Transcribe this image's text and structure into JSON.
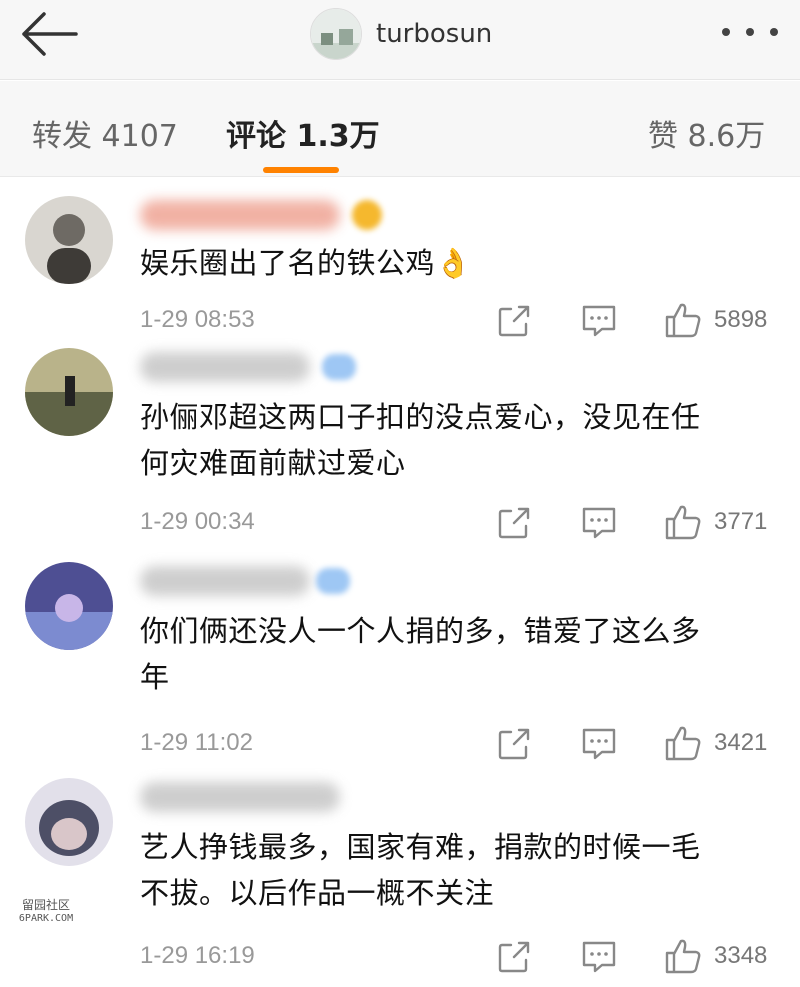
{
  "header": {
    "back_icon": "arrow-left-icon",
    "username": "turbosun",
    "more_icon": "more-dots-icon"
  },
  "tabs": [
    {
      "label": "转发 4107",
      "active": false
    },
    {
      "label": "评论 1.3万",
      "active": true
    },
    {
      "label": "赞 8.6万",
      "active": false
    }
  ],
  "accent_color": "#ff8200",
  "comments": [
    {
      "content": [
        "娱乐圈出了名的铁公鸡👌"
      ],
      "time": "1-29 08:53",
      "likes": "5898"
    },
    {
      "content": [
        "孙俪邓超这两口子扣的没点爱心，没见在任",
        "何灾难面前献过爱心"
      ],
      "time": "1-29 00:34",
      "likes": "3771"
    },
    {
      "content": [
        "你们俩还没人一个人捐的多，错爱了这么多",
        "年"
      ],
      "time": "1-29 11:02",
      "likes": "3421"
    },
    {
      "content": [
        "艺人挣钱最多，国家有难，捐款的时候一毛",
        "不拔。以后作品一概不关注"
      ],
      "time": "1-29 16:19",
      "likes": "3348"
    }
  ],
  "actions": {
    "share_icon": "share-icon",
    "comment_icon": "comment-icon",
    "like_icon": "thumbs-up-icon"
  },
  "watermark": {
    "top": "留园社区",
    "bottom": "6PARK.COM"
  }
}
